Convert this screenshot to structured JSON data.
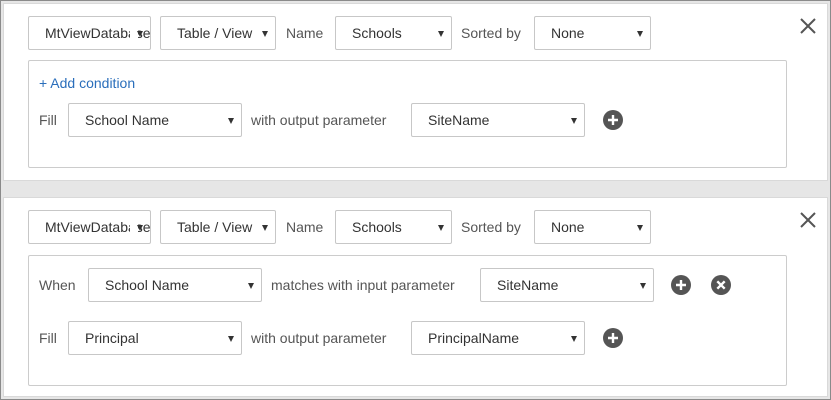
{
  "block1": {
    "database": "MtViewDatabase",
    "source_type": "Table / View",
    "name_label": "Name",
    "name_value": "Schools",
    "sorted_label": "Sorted by",
    "sorted_value": "None",
    "add_condition": "+ Add condition",
    "fill_label": "Fill",
    "fill_field": "School Name",
    "output_label": "with output parameter",
    "output_param": "SiteName"
  },
  "block2": {
    "database": "MtViewDatabase",
    "source_type": "Table / View",
    "name_label": "Name",
    "name_value": "Schools",
    "sorted_label": "Sorted by",
    "sorted_value": "None",
    "when_label": "When",
    "when_field": "School Name",
    "matches_label": "matches with input parameter",
    "input_param": "SiteName",
    "fill_label": "Fill",
    "fill_field": "Principal",
    "output_label": "with output parameter",
    "output_param": "PrincipalName"
  },
  "icons": {
    "close": "close-icon",
    "add": "plus-circle-icon",
    "remove": "x-circle-icon"
  },
  "colors": {
    "link": "#2a6ebb",
    "icon_circle": "#555555",
    "border": "#c7c7c7"
  }
}
